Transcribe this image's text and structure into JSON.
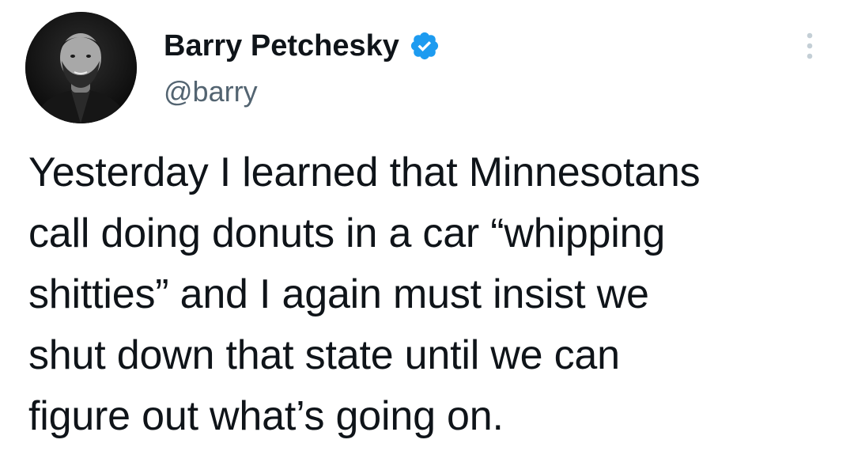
{
  "author": {
    "display_name": "Barry Petchesky",
    "handle": "@barry",
    "verified": true,
    "avatar": "profile-photo-avatar"
  },
  "tweet": {
    "lines": [
      "Yesterday I learned that Minnesotans",
      "call doing donuts in a car “whipping",
      "shitties” and I again must insist we",
      "shut down that state until we can",
      "figure out what’s going on."
    ]
  },
  "icons": {
    "verified": "verified-badge-icon",
    "more": "more-options-icon"
  },
  "colors": {
    "text": "#0f1419",
    "secondary": "#536471",
    "verified_blue": "#1d9bf0"
  }
}
